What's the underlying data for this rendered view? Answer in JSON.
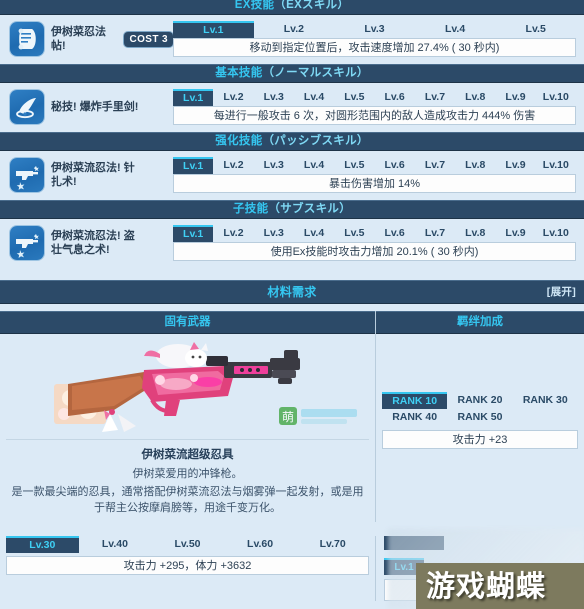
{
  "sections": {
    "ex": {
      "cn": "EX技能",
      "jp": "（EXスキル）"
    },
    "normal": {
      "cn": "基本技能",
      "jp": "（ノーマルスキル）"
    },
    "passive": {
      "cn": "强化技能",
      "jp": "（パッシブスキル）"
    },
    "sub": {
      "cn": "子技能",
      "jp": "（サブスキル）"
    },
    "materials": {
      "cn": "材料需求",
      "action": "[展开]"
    }
  },
  "skills": [
    {
      "id": "ex",
      "name": "伊树菜忍法帖!",
      "icon": "scroll-icon",
      "cost_label": "COST 3",
      "levels": [
        "Lv.1",
        "Lv.2",
        "Lv.3",
        "Lv.4",
        "Lv.5"
      ],
      "active_level": 0,
      "description": "移动到指定位置后，攻击速度增加 27.4% ( 30 秒内)"
    },
    {
      "id": "normal",
      "name": "秘技! 爆炸手里剑!",
      "icon": "shuriken-icon",
      "levels": [
        "Lv.1",
        "Lv.2",
        "Lv.3",
        "Lv.4",
        "Lv.5",
        "Lv.6",
        "Lv.7",
        "Lv.8",
        "Lv.9",
        "Lv.10"
      ],
      "active_level": 0,
      "description": "每进行一般攻击 6 次，对圆形范围内的敌人造成攻击力 444% 伤害"
    },
    {
      "id": "passive",
      "name": "伊树菜流忍法! 针扎术!",
      "icon": "gun-icon",
      "levels": [
        "Lv.1",
        "Lv.2",
        "Lv.3",
        "Lv.4",
        "Lv.5",
        "Lv.6",
        "Lv.7",
        "Lv.8",
        "Lv.9",
        "Lv.10"
      ],
      "active_level": 0,
      "description": "暴击伤害增加 14%"
    },
    {
      "id": "sub",
      "name": "伊树菜流忍法! 盗壮气息之术!",
      "icon": "gun-icon",
      "levels": [
        "Lv.1",
        "Lv.2",
        "Lv.3",
        "Lv.4",
        "Lv.5",
        "Lv.6",
        "Lv.7",
        "Lv.8",
        "Lv.9",
        "Lv.10"
      ],
      "active_level": 0,
      "description": "使用Ex技能时攻击力增加 20.1% ( 30 秒内)"
    }
  ],
  "weapon": {
    "panel_title": "固有武器",
    "name": "伊树菜流超级忍具",
    "subtitle": "伊树菜爱用的冲锋枪。",
    "description": "是一款最尖端的忍具，通常搭配伊树菜流忍法与烟雾弹一起发射，或是用于帮主公按摩肩膀等，用途千变万化。",
    "levels": [
      "Lv.30",
      "Lv.40",
      "Lv.50",
      "Lv.60",
      "Lv.70"
    ],
    "active_level": 0,
    "stats": "攻击力 +295，体力 +3632",
    "image_watermark": "萌"
  },
  "bond": {
    "panel_title": "羁绊加成",
    "ranks": [
      "RANK 10",
      "RANK 20",
      "RANK 30",
      "RANK 40",
      "RANK 50"
    ],
    "active_rank": 0,
    "effect": "攻击力 +23",
    "bottom_level_label": "Lv.1"
  },
  "watermark": {
    "text": "游戏蝴蝶"
  },
  "colors": {
    "page_bg": "#dceaf6",
    "bar_bg": "#2c4a68",
    "accent_cyan": "#35c6f0",
    "text_dark": "#2a3b4d",
    "box_bg": "#fdfdfd"
  }
}
